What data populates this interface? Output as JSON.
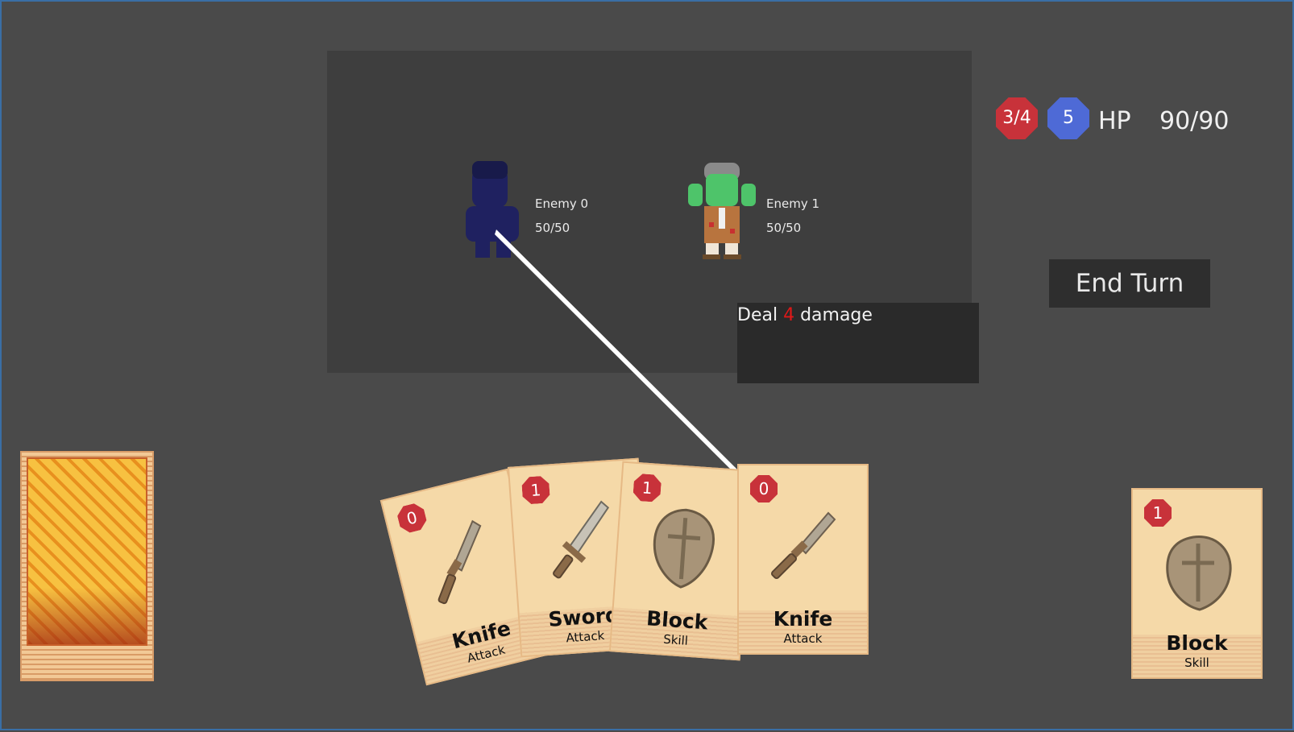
{
  "player": {
    "energy": "3/4",
    "block": "5",
    "hp_label": "HP",
    "hp_value": "90/90"
  },
  "enemies": [
    {
      "name": "Enemy 0",
      "hp": "50/50"
    },
    {
      "name": "Enemy 1",
      "hp": "50/50"
    }
  ],
  "tooltip": {
    "prefix": "Deal",
    "amount": "4",
    "suffix": "damage"
  },
  "end_turn_label": "End Turn",
  "hand": [
    {
      "cost": "0",
      "name": "Knife",
      "type": "Attack",
      "icon": "knife-icon"
    },
    {
      "cost": "1",
      "name": "Sword",
      "type": "Attack",
      "icon": "sword-icon"
    },
    {
      "cost": "1",
      "name": "Block",
      "type": "Skill",
      "icon": "shield-icon"
    },
    {
      "cost": "0",
      "name": "Knife",
      "type": "Attack",
      "icon": "knife-icon"
    }
  ],
  "discard_top": {
    "cost": "1",
    "name": "Block",
    "type": "Skill",
    "icon": "shield-icon"
  },
  "colors": {
    "cost_badge": "#c8323a",
    "block_badge": "#4e6ad6",
    "damage_number": "#e01818",
    "card_face": "#f5d9a8"
  }
}
